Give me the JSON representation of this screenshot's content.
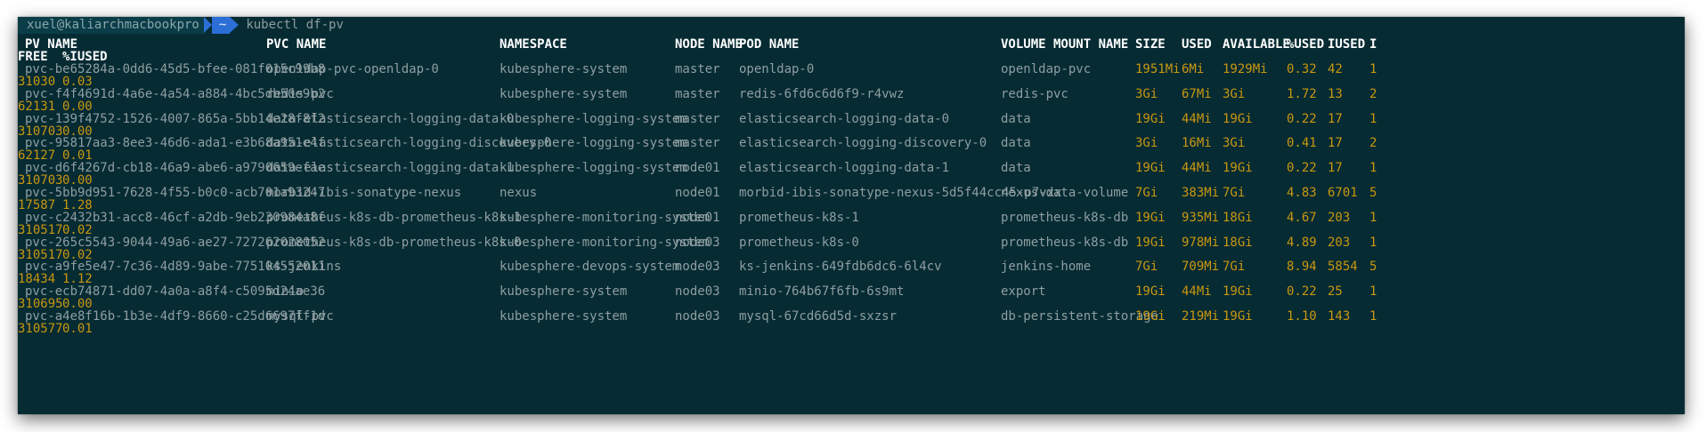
{
  "prompt": {
    "user_host": "xuel@kaliarchmacbookpro",
    "directory": "~",
    "command": "kubectl df-pv"
  },
  "table": {
    "columns": [
      "PV NAME",
      "PVC NAME",
      "NAMESPACE",
      "NODE NAME",
      "POD NAME",
      "VOLUME MOUNT NAME",
      "SIZE",
      "USED",
      "AVAILABLE",
      "%USED",
      "IUSED",
      "I"
    ],
    "wrapped_columns": [
      "FREE",
      "%IUSED"
    ],
    "rows": [
      {
        "pv": "pvc-be65284a-0dd6-45d5-bfee-081f015c99b8",
        "pvc": "openldap-pvc-openldap-0",
        "ns": "kubesphere-system",
        "node": "master",
        "pod": "openldap-0",
        "mount": "openldap-pvc",
        "size": "1951Mi",
        "used": "6Mi",
        "avail": "1929Mi",
        "pct": "0.32",
        "iused": "42",
        "ifree_start": "1",
        "ifree": "31030",
        "pctiused": "0.03"
      },
      {
        "pv": "pvc-f4f4691d-4a6e-4a54-a884-4bc5db50e9b2",
        "pvc": "redis-pvc",
        "ns": "kubesphere-system",
        "node": "master",
        "pod": "redis-6fd6c6d6f9-r4vwz",
        "mount": "redis-pvc",
        "size": "3Gi",
        "used": "67Mi",
        "avail": "3Gi",
        "pct": "1.72",
        "iused": "13",
        "ifree_start": "2",
        "ifree": "62131",
        "pctiused": "0.00"
      },
      {
        "pv": "pvc-139f4752-1526-4007-865a-5bb14e28f8f2",
        "pvc": "data-elasticsearch-logging-data-0",
        "ns": "kubesphere-logging-system",
        "node": "master",
        "pod": "elasticsearch-logging-data-0",
        "mount": "data",
        "size": "19Gi",
        "used": "44Mi",
        "avail": "19Gi",
        "pct": "0.22",
        "iused": "17",
        "ifree_start": "1",
        "ifree": "310703",
        "pctiused": "0.00"
      },
      {
        "pv": "pvc-95817aa3-8ee3-46d6-ada1-e3b68a951e4f",
        "pvc": "data-elasticsearch-logging-discovery-0",
        "ns": "kubesphere-logging-system",
        "node": "master",
        "pod": "elasticsearch-logging-discovery-0",
        "mount": "data",
        "size": "3Gi",
        "used": "16Mi",
        "avail": "3Gi",
        "pct": "0.41",
        "iused": "17",
        "ifree_start": "2",
        "ifree": "62127",
        "pctiused": "0.01"
      },
      {
        "pv": "pvc-d6f4267d-cb18-46a9-abe6-a9790659efae",
        "pvc": "data-elasticsearch-logging-data-1",
        "ns": "kubesphere-logging-system",
        "node": "node01",
        "pod": "elasticsearch-logging-data-1",
        "mount": "data",
        "size": "19Gi",
        "used": "44Mi",
        "avail": "19Gi",
        "pct": "0.22",
        "iused": "17",
        "ifree_start": "1",
        "ifree": "310703",
        "pctiused": "0.00"
      },
      {
        "pv": "pvc-5bb9d951-7628-4f55-b0c0-acb701a93247",
        "pvc": "morbid-ibis-sonatype-nexus",
        "ns": "nexus",
        "node": "node01",
        "pod": "morbid-ibis-sonatype-nexus-5d5f44cc45-p7vxx",
        "mount": "nexus-data-volume",
        "size": "7Gi",
        "used": "383Mi",
        "avail": "7Gi",
        "pct": "4.83",
        "iused": "6701",
        "ifree_start": "5",
        "ifree": "17587",
        "pctiused": "1.28"
      },
      {
        "pv": "pvc-c2432b31-acc8-46cf-a2db-9eb230984a8f",
        "pvc": "prometheus-k8s-db-prometheus-k8s-1",
        "ns": "kubesphere-monitoring-system",
        "node": "node01",
        "pod": "prometheus-k8s-1",
        "mount": "prometheus-k8s-db",
        "size": "19Gi",
        "used": "935Mi",
        "avail": "18Gi",
        "pct": "4.67",
        "iused": "203",
        "ifree_start": "1",
        "ifree": "310517",
        "pctiused": "0.02"
      },
      {
        "pv": "pvc-265c5543-9044-49a6-ae27-727262028052",
        "pvc": "prometheus-k8s-db-prometheus-k8s-0",
        "ns": "kubesphere-monitoring-system",
        "node": "node03",
        "pod": "prometheus-k8s-0",
        "mount": "prometheus-k8s-db",
        "size": "19Gi",
        "used": "978Mi",
        "avail": "18Gi",
        "pct": "4.89",
        "iused": "203",
        "ifree_start": "1",
        "ifree": "310517",
        "pctiused": "0.02"
      },
      {
        "pv": "pvc-a9fe5e47-7c36-4d89-9abe-775104552011",
        "pvc": "ks-jenkins",
        "ns": "kubesphere-devops-system",
        "node": "node03",
        "pod": "ks-jenkins-649fdb6dc6-6l4cv",
        "mount": "jenkins-home",
        "size": "7Gi",
        "used": "709Mi",
        "avail": "7Gi",
        "pct": "8.94",
        "iused": "5854",
        "ifree_start": "5",
        "ifree": "18434",
        "pctiused": "1.12"
      },
      {
        "pv": "pvc-ecb74871-dd07-4a0a-a8f4-c5095d24ae36",
        "pvc": "minio",
        "ns": "kubesphere-system",
        "node": "node03",
        "pod": "minio-764b67f6fb-6s9mt",
        "mount": "export",
        "size": "19Gi",
        "used": "44Mi",
        "avail": "19Gi",
        "pct": "0.22",
        "iused": "25",
        "ifree_start": "1",
        "ifree": "310695",
        "pctiused": "0.00"
      },
      {
        "pv": "pvc-a4e8f16b-1b3e-4df9-8660-c25d6697ff1d",
        "pvc": "mysql-pvc",
        "ns": "kubesphere-system",
        "node": "node03",
        "pod": "mysql-67cd66d5d-sxzsr",
        "mount": "db-persistent-storage",
        "size": "19Gi",
        "used": "219Mi",
        "avail": "19Gi",
        "pct": "1.10",
        "iused": "143",
        "ifree_start": "1",
        "ifree": "310577",
        "pctiused": "0.01"
      }
    ]
  },
  "colors": {
    "terminal_bg": "#062b33",
    "default_text": "#8f9ea1",
    "header_text": "#ffffff",
    "numeric_text": "#c99710",
    "prompt_dir_bg": "#2b6fd6"
  }
}
